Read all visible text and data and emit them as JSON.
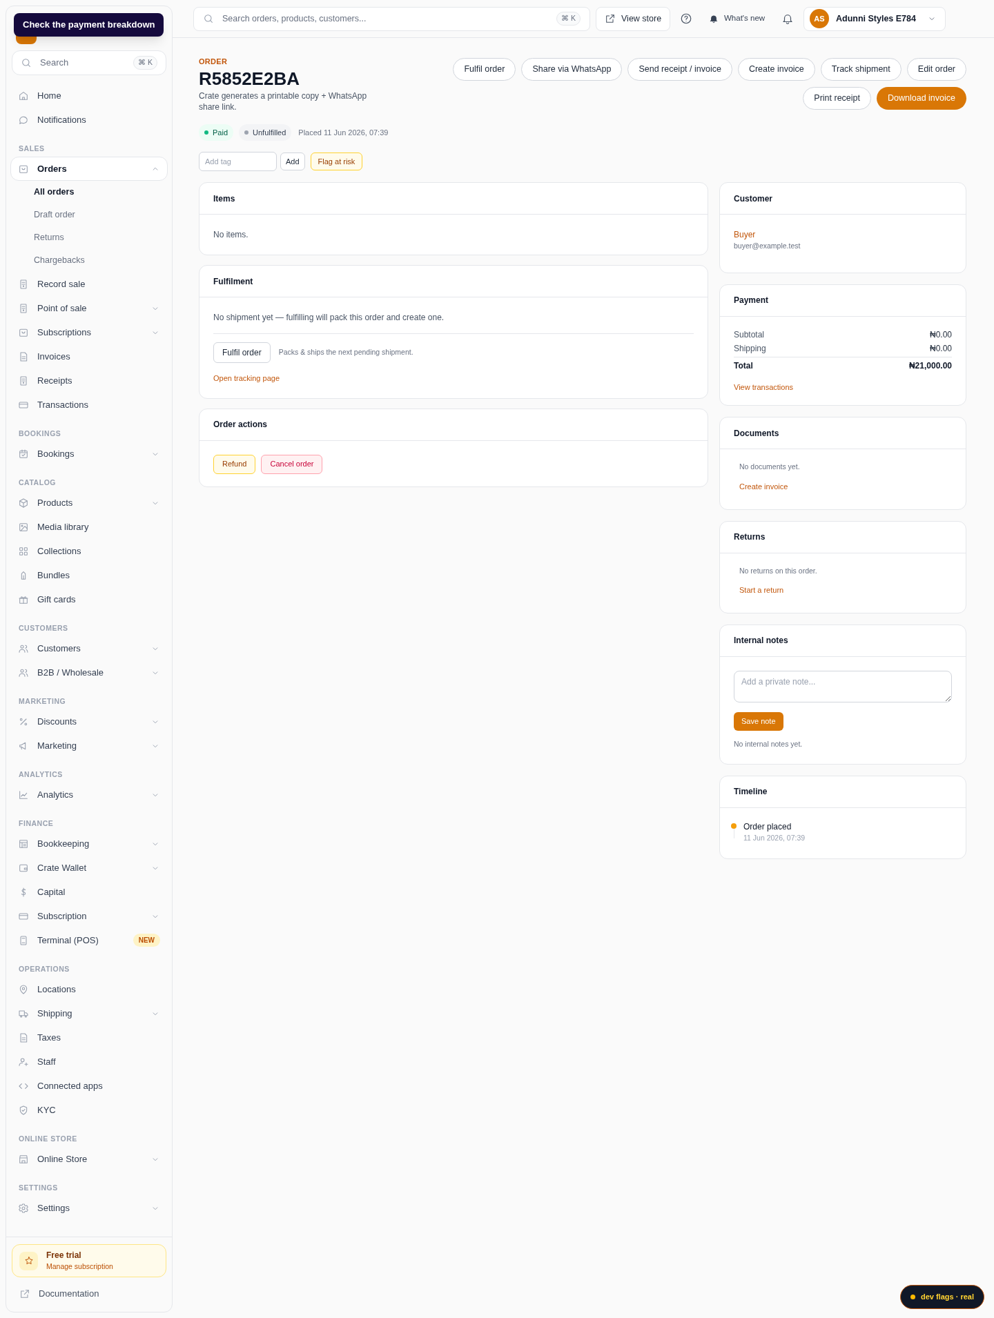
{
  "tooltip": "Check the payment breakdown",
  "sidebar": {
    "search": {
      "placeholder": "Search",
      "shortcut": "⌘ K"
    },
    "sections": [
      {
        "items": [
          {
            "label": "Home",
            "kind": "link",
            "selected": false
          },
          {
            "label": "Notifications",
            "kind": "link",
            "selected": false
          }
        ]
      },
      {
        "heading": "SALES",
        "items": [
          {
            "label": "Orders",
            "kind": "group",
            "selected": true,
            "expanded": true,
            "children": [
              {
                "label": "All orders",
                "selected": true
              },
              {
                "label": "Draft order",
                "selected": false
              },
              {
                "label": "Returns",
                "selected": false
              },
              {
                "label": "Chargebacks",
                "selected": false
              }
            ]
          },
          {
            "label": "Record sale",
            "kind": "link",
            "selected": false
          },
          {
            "label": "Point of sale",
            "kind": "group",
            "selected": false,
            "expanded": false
          },
          {
            "label": "Subscriptions",
            "kind": "group",
            "selected": false,
            "expanded": false
          },
          {
            "label": "Invoices",
            "kind": "link",
            "selected": false
          },
          {
            "label": "Receipts",
            "kind": "link",
            "selected": false
          },
          {
            "label": "Transactions",
            "kind": "link",
            "selected": false
          }
        ]
      },
      {
        "heading": "BOOKINGS",
        "items": [
          {
            "label": "Bookings",
            "kind": "group",
            "selected": false,
            "expanded": false
          }
        ]
      },
      {
        "heading": "CATALOG",
        "items": [
          {
            "label": "Products",
            "kind": "group",
            "selected": false,
            "expanded": false
          },
          {
            "label": "Media library",
            "kind": "link",
            "selected": false
          },
          {
            "label": "Collections",
            "kind": "link",
            "selected": false
          },
          {
            "label": "Bundles",
            "kind": "link",
            "selected": false
          },
          {
            "label": "Gift cards",
            "kind": "link",
            "selected": false
          }
        ]
      },
      {
        "heading": "CUSTOMERS",
        "items": [
          {
            "label": "Customers",
            "kind": "group",
            "selected": false,
            "expanded": false
          },
          {
            "label": "B2B / Wholesale",
            "kind": "group",
            "selected": false,
            "expanded": false
          }
        ]
      },
      {
        "heading": "MARKETING",
        "items": [
          {
            "label": "Discounts",
            "kind": "group",
            "selected": false,
            "expanded": false
          },
          {
            "label": "Marketing",
            "kind": "group",
            "selected": false,
            "expanded": false
          }
        ]
      },
      {
        "heading": "ANALYTICS",
        "items": [
          {
            "label": "Analytics",
            "kind": "group",
            "selected": false,
            "expanded": false
          }
        ]
      },
      {
        "heading": "FINANCE",
        "items": [
          {
            "label": "Bookkeeping",
            "kind": "group",
            "selected": false,
            "expanded": false
          },
          {
            "label": "Crate Wallet",
            "kind": "group",
            "selected": false,
            "expanded": false
          },
          {
            "label": "Capital",
            "kind": "link",
            "selected": false
          },
          {
            "label": "Subscription",
            "kind": "group",
            "selected": false,
            "expanded": false
          },
          {
            "label": "Terminal (POS)",
            "kind": "link",
            "selected": false,
            "badge": "NEW"
          }
        ]
      },
      {
        "heading": "OPERATIONS",
        "items": [
          {
            "label": "Locations",
            "kind": "link",
            "selected": false
          },
          {
            "label": "Shipping",
            "kind": "group",
            "selected": false,
            "expanded": false
          },
          {
            "label": "Taxes",
            "kind": "link",
            "selected": false
          },
          {
            "label": "Staff",
            "kind": "link",
            "selected": false
          },
          {
            "label": "Connected apps",
            "kind": "link",
            "selected": false
          },
          {
            "label": "KYC",
            "kind": "link",
            "selected": false
          }
        ]
      },
      {
        "heading": "ONLINE STORE",
        "items": [
          {
            "label": "Online Store",
            "kind": "group",
            "selected": false,
            "expanded": false
          }
        ]
      },
      {
        "heading": "SETTINGS",
        "items": [
          {
            "label": "Settings",
            "kind": "group",
            "selected": false,
            "expanded": false
          }
        ]
      }
    ],
    "trial": {
      "title": "Free trial",
      "subtitle": "Manage subscription"
    },
    "footer_link": "Documentation"
  },
  "topbar": {
    "search": {
      "placeholder": "Search orders, products, customers...",
      "shortcut": "⌘ K"
    },
    "view_store": "View store",
    "whats_new": "What's new",
    "account": {
      "initials": "AS",
      "name": "Adunni Styles E784"
    }
  },
  "order": {
    "eyebrow": "ORDER",
    "number": "R5852E2BA",
    "description": "Crate generates a printable copy + WhatsApp share link.",
    "actions": [
      {
        "label": "Fulfil order",
        "primary": false
      },
      {
        "label": "Share via WhatsApp",
        "primary": false
      },
      {
        "label": "Send receipt / invoice",
        "primary": false
      },
      {
        "label": "Create invoice",
        "primary": false
      },
      {
        "label": "Track shipment",
        "primary": false
      },
      {
        "label": "Edit order",
        "primary": false
      }
    ],
    "actions_row2": [
      {
        "label": "Print receipt",
        "primary": false
      },
      {
        "label": "Download invoice",
        "primary": true
      }
    ],
    "badges": [
      {
        "label": "Paid",
        "color": "#10b981"
      },
      {
        "label": "Unfulfilled",
        "color": "#9ca3af"
      }
    ],
    "placed": "Placed 11 Jun 2026, 07:39",
    "tag": {
      "placeholder": "Add tag",
      "add": "Add",
      "flag": "Flag at risk"
    }
  },
  "items": {
    "title": "Items",
    "empty": "No items."
  },
  "fulfilment": {
    "title": "Fulfilment",
    "message": "No shipment yet — fulfilling will pack this order and create one.",
    "button": "Fulfil order",
    "hint": "Packs & ships the next pending shipment.",
    "link": "Open tracking page"
  },
  "order_actions": {
    "title": "Order actions",
    "buttons": [
      {
        "label": "Refund",
        "kind": "warning"
      },
      {
        "label": "Cancel order",
        "kind": "danger"
      }
    ]
  },
  "customer": {
    "title": "Customer",
    "name": "Buyer",
    "email": "buyer@example.test"
  },
  "payment": {
    "title": "Payment",
    "rows": [
      {
        "label": "Subtotal",
        "value": "₦0.00",
        "kind": "line"
      },
      {
        "label": "Shipping",
        "value": "₦0.00",
        "kind": "line"
      },
      {
        "label": "Total",
        "value": "₦21,000.00",
        "kind": "total"
      }
    ],
    "link": "View transactions"
  },
  "documents": {
    "title": "Documents",
    "empty": "No documents yet.",
    "link": "Create invoice"
  },
  "returns": {
    "title": "Returns",
    "empty": "No returns on this order.",
    "link": "Start a return"
  },
  "notes": {
    "title": "Internal notes",
    "placeholder": "Add a private note...",
    "button": "Save note",
    "empty": "No internal notes yet."
  },
  "timeline": {
    "title": "Timeline",
    "events": [
      {
        "title": "Order placed",
        "time": "11 Jun 2026, 07:39",
        "color": "#f59e0b"
      }
    ]
  },
  "dev_flags": "dev flags · real"
}
